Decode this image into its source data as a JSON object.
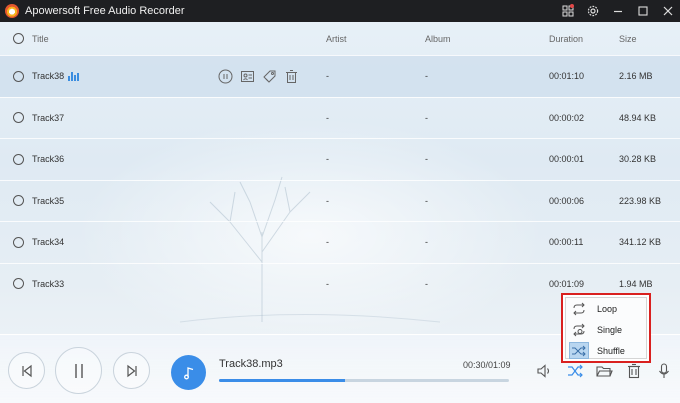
{
  "app": {
    "title": "Apowersoft Free Audio Recorder"
  },
  "table": {
    "headers": {
      "title": "Title",
      "artist": "Artist",
      "album": "Album",
      "duration": "Duration",
      "size": "Size"
    },
    "rows": [
      {
        "title": "Track38",
        "artist": "-",
        "album": "-",
        "duration": "00:01:10",
        "size": "2.16 MB"
      },
      {
        "title": "Track37",
        "artist": "-",
        "album": "-",
        "duration": "00:00:02",
        "size": "48.94 KB"
      },
      {
        "title": "Track36",
        "artist": "-",
        "album": "-",
        "duration": "00:00:01",
        "size": "30.28 KB"
      },
      {
        "title": "Track35",
        "artist": "-",
        "album": "-",
        "duration": "00:00:06",
        "size": "223.98 KB"
      },
      {
        "title": "Track34",
        "artist": "-",
        "album": "-",
        "duration": "00:00:11",
        "size": "341.12 KB"
      },
      {
        "title": "Track33",
        "artist": "-",
        "album": "-",
        "duration": "00:01:09",
        "size": "1.94 MB"
      }
    ]
  },
  "player": {
    "track_name": "Track38.mp3",
    "time": "00:30/01:09",
    "progress_fraction": 0.435
  },
  "play_mode": {
    "items": [
      {
        "label": "Loop",
        "icon": "loop-icon"
      },
      {
        "label": "Single",
        "icon": "single-loop-icon"
      },
      {
        "label": "Shuffle",
        "icon": "shuffle-icon"
      }
    ],
    "active": "Shuffle"
  },
  "colors": {
    "accent": "#3a8de8",
    "titlebar": "#1e1f22",
    "highlight_border": "#d9201f"
  }
}
